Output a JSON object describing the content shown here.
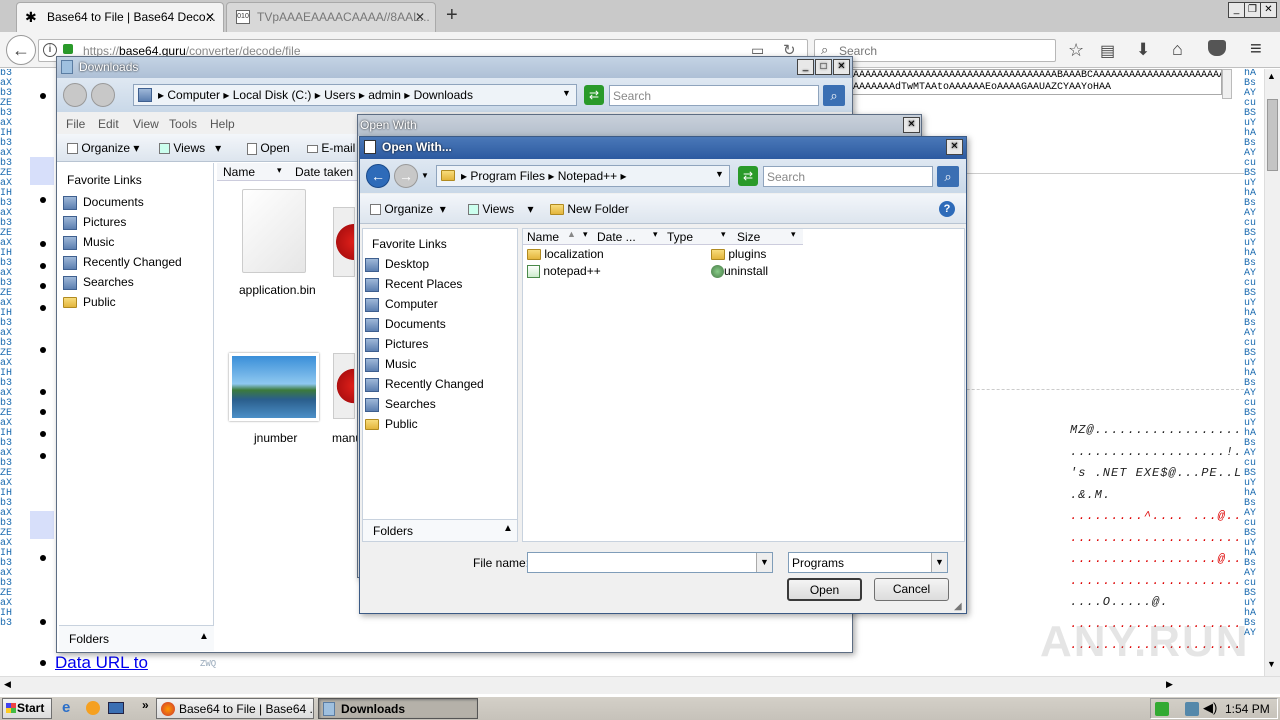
{
  "browser": {
    "tabs": [
      {
        "title": "Base64 to File | Base64 Deco..."
      },
      {
        "title": "TVpAAAEAAAACAAAA//8AAL..."
      }
    ],
    "new_tab": "+",
    "url_prefix": "https://",
    "url_host": "base64.guru",
    "url_path": "/converter/decode/file",
    "search_placeholder": "Search",
    "window_controls": {
      "minimize": "_",
      "restore": "❐",
      "close": "✕"
    }
  },
  "page": {
    "encoded_line1": "AAAAAAAAAAAAAAAAAAAAAAAAAAAAAAAAAABAAABCAAAAAAAAAAAAAAAAAAAAAA",
    "encoded_line2": "AAAAAAAdTwMTAAtoAAAAAAEoAAAAGAAUAZCYAAYoHAA",
    "hex_lines": [
      "MZ@.....................",
      "...................!...L",
      "'s .NET EXE$@...PE..L.",
      ".&.M.",
      ".........^....  ...@...",
      "...........................",
      "..................@.....",
      "...........................",
      "....O.....@.",
      "...........................",
      "..........................."
    ],
    "side_codes_left": [
      "b3",
      "aX",
      "b3",
      "ZE",
      "b3",
      "aX",
      "IH",
      "b3",
      "aX",
      "b3",
      "ZE",
      "aX",
      "IH",
      "b3",
      "aX",
      "b3",
      "ZE",
      "aX",
      "IH",
      "b3",
      "aX",
      "b3",
      "ZE",
      "aX",
      "IH",
      "b3",
      "aX",
      "b3",
      "ZE",
      "aX",
      "IH",
      "b3",
      "aX",
      "b3",
      "ZE",
      "aX",
      "IH",
      "b3",
      "aX",
      "b3",
      "ZE",
      "aX",
      "IH",
      "b3",
      "aX",
      "b3",
      "ZE",
      "aX",
      "IH",
      "b3",
      "aX",
      "b3",
      "ZE",
      "aX",
      "IH",
      "b3"
    ],
    "side_codes_right": [
      "hA",
      "Bs",
      "AY",
      "cu",
      "BS",
      "uY",
      "hA",
      "Bs",
      "AY",
      "cu",
      "BS",
      "uY",
      "hA",
      "Bs",
      "AY",
      "cu",
      "BS",
      "uY",
      "hA",
      "Bs",
      "AY",
      "cu",
      "BS",
      "uY",
      "hA",
      "Bs",
      "AY",
      "cu",
      "BS",
      "uY",
      "hA",
      "Bs",
      "AY",
      "cu",
      "BS",
      "uY",
      "hA",
      "Bs",
      "AY",
      "cu",
      "BS",
      "uY",
      "hA",
      "Bs",
      "AY",
      "cu",
      "BS",
      "uY",
      "hA",
      "Bs",
      "AY",
      "cu",
      "BS",
      "uY",
      "hA",
      "Bs",
      "AY"
    ],
    "link_data_url": "Data URL to",
    "small_code": "ZWQ",
    "watermark": "ANY.RUN"
  },
  "downloads_window": {
    "title": "Downloads",
    "breadcrumb": [
      "Computer",
      "Local Disk (C:)",
      "Users",
      "admin",
      "Downloads"
    ],
    "search_placeholder": "Search",
    "menu": [
      "File",
      "Edit",
      "View",
      "Tools",
      "Help"
    ],
    "toolbar": {
      "organize": "Organize",
      "views": "Views",
      "open": "Open",
      "email": "E-mail"
    },
    "favorite_links_header": "Favorite Links",
    "favorites": [
      "Documents",
      "Pictures",
      "Music",
      "Recently Changed",
      "Searches",
      "Public"
    ],
    "folders_label": "Folders",
    "columns": [
      "Name",
      "Date taken"
    ],
    "files": [
      {
        "name": "application.bin",
        "kind": "blank"
      },
      {
        "name": "",
        "kind": "flower"
      },
      {
        "name": "jnumber",
        "kind": "landscape"
      },
      {
        "name": "manu",
        "kind": "flower"
      }
    ]
  },
  "open_with_outer": {
    "title": "Open With"
  },
  "open_with_dialog": {
    "title": "Open With...",
    "breadcrumb": [
      "Program Files",
      "Notepad++"
    ],
    "search_placeholder": "Search",
    "toolbar": {
      "organize": "Organize",
      "views": "Views",
      "new_folder": "New Folder"
    },
    "favorite_links_header": "Favorite Links",
    "favorites": [
      "Desktop",
      "Recent Places",
      "Computer",
      "Documents",
      "Pictures",
      "Music",
      "Recently Changed",
      "Searches",
      "Public"
    ],
    "folders_label": "Folders",
    "columns": [
      "Name",
      "Date ...",
      "Type",
      "Size"
    ],
    "items": [
      {
        "name": "localization",
        "kind": "folder"
      },
      {
        "name": "plugins",
        "kind": "folder"
      },
      {
        "name": "notepad++",
        "kind": "exe"
      },
      {
        "name": "uninstall",
        "kind": "exe"
      }
    ],
    "file_name_label": "File name:",
    "file_name_value": "",
    "file_type_value": "Programs",
    "open_button": "Open",
    "cancel_button": "Cancel"
  },
  "taskbar": {
    "start": "Start",
    "chevron": "»",
    "tasks": [
      "Base64 to File | Base64 ...",
      "Downloads"
    ],
    "clock": "1:54 PM"
  }
}
